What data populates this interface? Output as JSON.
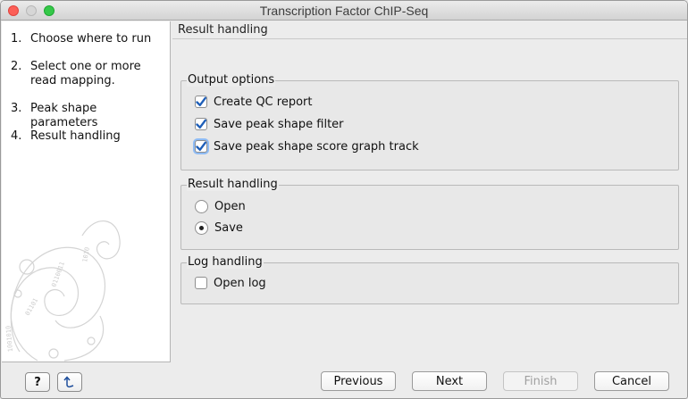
{
  "window": {
    "title": "Transcription Factor ChIP-Seq"
  },
  "sidebar": {
    "steps": [
      {
        "num": "1.",
        "label": "Choose where to run"
      },
      {
        "num": "2.",
        "label": "Select one or more read mapping."
      },
      {
        "num": "3.",
        "label": "Peak shape parameters"
      },
      {
        "num": "4.",
        "label": "Result handling"
      }
    ]
  },
  "main": {
    "section_title": "Result handling",
    "output_options": {
      "title": "Output options",
      "items": [
        {
          "label": "Create QC report",
          "checked": true
        },
        {
          "label": "Save peak shape filter",
          "checked": true
        },
        {
          "label": "Save peak shape score graph track",
          "checked": true
        }
      ]
    },
    "result_handling": {
      "title": "Result handling",
      "options": [
        {
          "label": "Open",
          "selected": false
        },
        {
          "label": "Save",
          "selected": true
        }
      ]
    },
    "log_handling": {
      "title": "Log handling",
      "items": [
        {
          "label": "Open log",
          "checked": false
        }
      ]
    }
  },
  "footer": {
    "help_label": "?",
    "previous_label": "Previous",
    "next_label": "Next",
    "finish_label": "Finish",
    "cancel_label": "Cancel"
  },
  "colors": {
    "checkbox_check": "#1f5fb8",
    "focus_ring": "#8fbcf5"
  }
}
